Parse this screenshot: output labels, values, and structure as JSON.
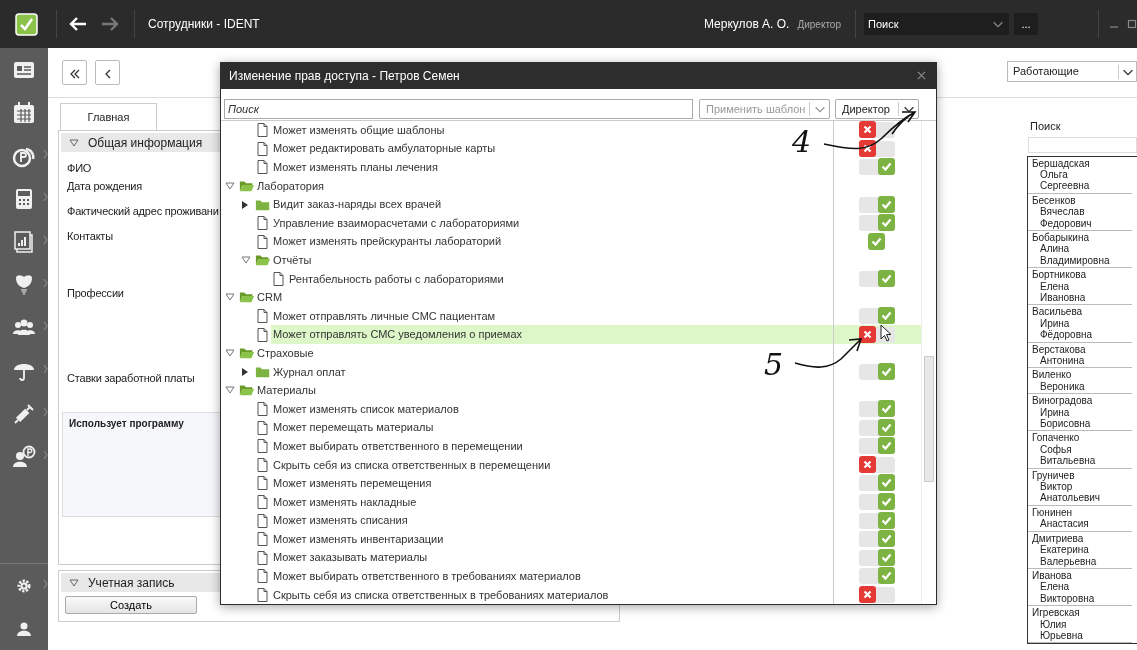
{
  "app": {
    "title": "Сотрудники - IDENT",
    "user": "Меркулов А. О.",
    "role": "Директор",
    "search": {
      "value": "Поиск"
    },
    "more": "..."
  },
  "filter": {
    "value": "Работающие"
  },
  "form": {
    "tab": {
      "label": "Главная",
      "selected": true
    },
    "section": "Общая информация",
    "fields": [
      "ФИО",
      "Дата рождения",
      "Фактический адрес проживани",
      "Контакты",
      "Профессии",
      "Ставки заработной платы"
    ],
    "uses_program": "Использует программу",
    "account_section": "Учетная запись",
    "create_button": "Создать"
  },
  "employee_search": {
    "label": "Поиск"
  },
  "employees": [
    {
      "surname": "Бершадская",
      "names": [
        "Ольга",
        "Сергеевна"
      ]
    },
    {
      "surname": "Бесенков",
      "names": [
        "Вячеслав",
        "Федорович"
      ]
    },
    {
      "surname": "Бобарыкина",
      "names": [
        "Алина",
        "Владимировна"
      ]
    },
    {
      "surname": "Бортникова",
      "names": [
        "Елена",
        "Ивановна"
      ]
    },
    {
      "surname": "Васильева",
      "names": [
        "Ирина",
        "Фёдоровна"
      ]
    },
    {
      "surname": "Верстакова",
      "names": [
        "Антонина"
      ]
    },
    {
      "surname": "Виленко",
      "names": [
        "Вероника"
      ]
    },
    {
      "surname": "Виноградова",
      "names": [
        "Ирина",
        "Борисовна"
      ]
    },
    {
      "surname": "Гопаченко",
      "names": [
        "Софья",
        "Витальевна"
      ]
    },
    {
      "surname": "Груничев",
      "names": [
        "Виктор",
        "Анатольевич"
      ]
    },
    {
      "surname": "Гюнинен",
      "names": [
        "Анастасия"
      ]
    },
    {
      "surname": "Дмитриева",
      "names": [
        "Екатерина",
        "Валерьевна"
      ]
    },
    {
      "surname": "Иванова",
      "names": [
        "Елена",
        "Викторовна"
      ]
    },
    {
      "surname": "Игревская",
      "names": [
        "Юлия",
        "Юрьевна"
      ]
    }
  ],
  "dialog": {
    "title": "Изменение прав доступа - Петров Семен",
    "search": {
      "placeholder": "Поиск"
    },
    "template": {
      "placeholder": "Применить шаблон"
    },
    "role": {
      "value": "Директор"
    },
    "tree": [
      {
        "kind": "partial",
        "children": [
          {
            "kind": "leaf",
            "label": "Может изменять общие шаблоны",
            "allowed": false,
            "inherited": false,
            "selected": false
          },
          {
            "kind": "leaf",
            "label": "Может редактировать амбулаторные карты",
            "allowed": false,
            "inherited": false,
            "selected": false
          },
          {
            "kind": "leaf",
            "label": "Может изменять планы лечения",
            "allowed": true,
            "inherited": false,
            "selected": false
          }
        ]
      },
      {
        "kind": "folder",
        "label": "Лаборатория",
        "expanded": true,
        "selected": false,
        "children": [
          {
            "kind": "folder",
            "label": "Видит заказ-наряды всех врачей",
            "expanded": false,
            "allowed": true,
            "inherited": false,
            "selected": false
          },
          {
            "kind": "leaf",
            "label": "Управление взаиморасчетами с лабораториями",
            "allowed": true,
            "inherited": false,
            "selected": false
          },
          {
            "kind": "leaf",
            "label": "Может изменять прейскуранты лабораторий",
            "allowed": true,
            "inherited": true,
            "selected": false
          },
          {
            "kind": "folder",
            "label": "Отчёты",
            "expanded": true,
            "selected": false,
            "children": [
              {
                "kind": "leaf",
                "label": "Рентабельность работы с лабораториями",
                "allowed": true,
                "inherited": false,
                "selected": false
              }
            ]
          }
        ]
      },
      {
        "kind": "folder",
        "label": "CRM",
        "expanded": true,
        "selected": false,
        "children": [
          {
            "kind": "leaf",
            "label": "Может отправлять личные СМС пациентам",
            "allowed": true,
            "inherited": false,
            "selected": false
          },
          {
            "kind": "leaf",
            "label": "Может отправлять СМС уведомления о приемах",
            "allowed": false,
            "inherited": false,
            "selected": true
          }
        ]
      },
      {
        "kind": "folder",
        "label": "Страховые",
        "expanded": true,
        "selected": false,
        "children": [
          {
            "kind": "folder",
            "label": "Журнал оплат",
            "expanded": false,
            "allowed": true,
            "inherited": false,
            "selected": false
          }
        ]
      },
      {
        "kind": "folder",
        "label": "Материалы",
        "expanded": true,
        "selected": false,
        "children": [
          {
            "kind": "leaf",
            "label": "Может изменять список материалов",
            "allowed": true,
            "inherited": false,
            "selected": false
          },
          {
            "kind": "leaf",
            "label": "Может перемещать материалы",
            "allowed": true,
            "inherited": false,
            "selected": false
          },
          {
            "kind": "leaf",
            "label": "Может выбирать ответственного в перемещении",
            "allowed": true,
            "inherited": false,
            "selected": false
          },
          {
            "kind": "leaf",
            "label": "Скрыть себя из списка ответственных в перемещении",
            "allowed": false,
            "inherited": false,
            "selected": false
          },
          {
            "kind": "leaf",
            "label": "Может изменять перемещения",
            "allowed": true,
            "inherited": false,
            "selected": false
          },
          {
            "kind": "leaf",
            "label": "Может изменять накладные",
            "allowed": true,
            "inherited": false,
            "selected": false
          },
          {
            "kind": "leaf",
            "label": "Может изменять списания",
            "allowed": true,
            "inherited": false,
            "selected": false
          },
          {
            "kind": "leaf",
            "label": "Может изменять инвентаризации",
            "allowed": true,
            "inherited": false,
            "selected": false
          },
          {
            "kind": "leaf",
            "label": "Может заказывать материалы",
            "allowed": true,
            "inherited": false,
            "selected": false
          },
          {
            "kind": "leaf",
            "label": "Может выбирать ответственного в требованиях материалов",
            "allowed": true,
            "inherited": false,
            "selected": false
          },
          {
            "kind": "leaf",
            "label": "Скрыть себя из списка ответственных в требованиях материалов",
            "allowed": false,
            "inherited": false,
            "selected": false
          }
        ]
      }
    ]
  },
  "annotations": [
    {
      "label": "4"
    },
    {
      "label": "5"
    }
  ]
}
